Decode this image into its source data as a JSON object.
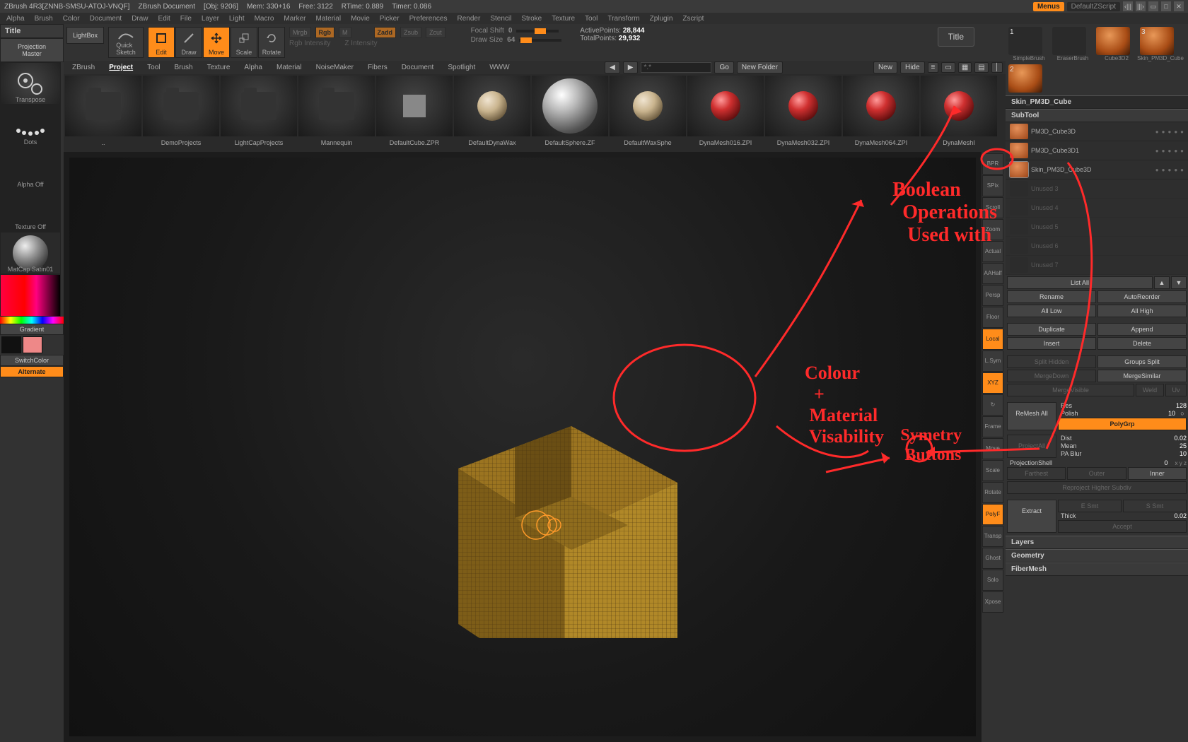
{
  "titlebar": {
    "app": "ZBrush 4R3[ZNNB-SMSU-ATOJ-VNQF]",
    "doc": "ZBrush Document",
    "obj": "[Obj: 9206]",
    "mem": "Mem: 330+16",
    "free": "Free: 3122",
    "rtime": "RTime: 0.889",
    "timer": "Timer: 0.086",
    "menus": "Menus",
    "script": "DefaultZScript"
  },
  "menus": [
    "Alpha",
    "Brush",
    "Color",
    "Document",
    "Draw",
    "Edit",
    "File",
    "Layer",
    "Light",
    "Macro",
    "Marker",
    "Material",
    "Movie",
    "Picker",
    "Preferences",
    "Render",
    "Stencil",
    "Stroke",
    "Texture",
    "Tool",
    "Transform",
    "Zplugin",
    "Zscript"
  ],
  "left": {
    "title": "Title",
    "projection": "Projection\nMaster",
    "lightbox": "LightBox",
    "quicksketch": "Quick\nSketch",
    "transpose": "Transpose",
    "dots": "Dots",
    "alphaoff": "Alpha Off",
    "textureoff": "Texture Off",
    "matcap": "MatCap Satin01",
    "gradient": "Gradient",
    "switch": "SwitchColor",
    "alternate": "Alternate"
  },
  "topbtns": {
    "edit": "Edit",
    "draw": "Draw",
    "move": "Move",
    "scale": "Scale",
    "rotate": "Rotate",
    "mrgb": "Mrgb",
    "rgb": "Rgb",
    "m": "M",
    "zadd": "Zadd",
    "zsub": "Zsub",
    "zcut": "Zcut",
    "rgbint": "Rgb Intensity",
    "zint": "Z Intensity",
    "focal": "Focal Shift",
    "focalv": "0",
    "drawsize": "Draw Size",
    "drawsizev": "64",
    "active": "ActivePoints:",
    "activev": "28,844",
    "total": "TotalPoints:",
    "totalv": "29,932",
    "titlebtn": "Title"
  },
  "filebar": {
    "tabs": [
      "ZBrush",
      "Project",
      "Tool",
      "Brush",
      "Texture",
      "Alpha",
      "Material",
      "NoiseMaker",
      "Fibers",
      "Document",
      "Spotlight",
      "WWW"
    ],
    "active": 1,
    "go": "Go",
    "newfolder": "New Folder",
    "new": "New",
    "hide": "Hide"
  },
  "thumbs": [
    {
      "cap": ".."
    },
    {
      "cap": "DemoProjects"
    },
    {
      "cap": "LightCapProjects"
    },
    {
      "cap": "Mannequin"
    },
    {
      "cap": "DefaultCube.ZPR"
    },
    {
      "cap": "DefaultDynaWax"
    },
    {
      "cap": "DefaultSphere.ZF"
    },
    {
      "cap": "DefaultWaxSphe"
    },
    {
      "cap": "DynaMesh016.ZPI"
    },
    {
      "cap": "DynaMesh032.ZPI"
    },
    {
      "cap": "DynaMesh064.ZPI"
    },
    {
      "cap": "DynaMeshI"
    }
  ],
  "sidetools": [
    "BPR",
    "SPix",
    "Scroll",
    "Zoom",
    "Actual",
    "AAHalf",
    "Persp",
    "Floor",
    "Local",
    "L.Sym",
    "XYZ",
    "↻",
    "Frame",
    "Move",
    "Scale",
    "Rotate",
    "PolyF",
    "Transp",
    "Ghost",
    "Solo",
    "Xpose"
  ],
  "sidetools_orange": [
    "Local",
    "XYZ",
    "PolyF"
  ],
  "right": {
    "topthumbs": [
      {
        "idx": "1",
        "cap": "SimpleBrush"
      },
      {
        "idx": "",
        "cap": "EraserBrush"
      },
      {
        "idx": "",
        "cap": "Cube3D2"
      },
      {
        "idx": "3",
        "cap": "Skin_PM3D_Cube"
      },
      {
        "idx": "2",
        "cap": ""
      }
    ],
    "tool": "Skin_PM3D_Cube",
    "subtool": "SubTool",
    "strows": [
      {
        "name": "PM3D_Cube3D",
        "sel": false
      },
      {
        "name": "PM3D_Cube3D1",
        "sel": false
      },
      {
        "name": "Skin_PM3D_Cube3D",
        "sel": true
      },
      {
        "name": "Unused 3",
        "dim": true
      },
      {
        "name": "Unused 4",
        "dim": true
      },
      {
        "name": "Unused 5",
        "dim": true
      },
      {
        "name": "Unused 6",
        "dim": true
      },
      {
        "name": "Unused 7",
        "dim": true
      }
    ],
    "btns": {
      "listall": "List All",
      "rename": "Rename",
      "autoreorder": "AutoReorder",
      "alllow": "All Low",
      "allhigh": "All High",
      "duplicate": "Duplicate",
      "append": "Append",
      "insert": "Insert",
      "delete": "Delete",
      "splithidden": "Split Hidden",
      "groupssplit": "Groups Split",
      "mergedown": "MergeDown",
      "mergesimilar": "MergeSimilar",
      "mergevisible": "MergeVisible",
      "weld": "Weld",
      "uv": "Uv",
      "remesh": "ReMesh All",
      "res": "Res",
      "resv": "128",
      "polish": "Polish",
      "polishv": "10",
      "polygrp": "PolyGrp",
      "projectall": "ProjectAll",
      "dist": "Dist",
      "distv": "0.02",
      "mean": "Mean",
      "meanv": "25",
      "pablur": "PA Blur",
      "pablurv": "10",
      "projshell": "ProjectionShell",
      "projshellv": "0",
      "farthest": "Farthest",
      "outer": "Outer",
      "inner": "Inner",
      "reproject": "Reproject Higher Subdiv",
      "extract": "Extract",
      "esmt": "E Smt",
      "ssmt": "S Smt",
      "thick": "Thick",
      "thickv": "0.02",
      "accept": "Accept",
      "layers": "Layers",
      "geometry": "Geometry",
      "fibermesh": "FiberMesh"
    }
  },
  "annot": {
    "boolean": "Boolean\n  Operations\n   Used with",
    "colour": "Colour\n  +\n Material\n Visability",
    "sym": "Symetry\n Buttons"
  }
}
